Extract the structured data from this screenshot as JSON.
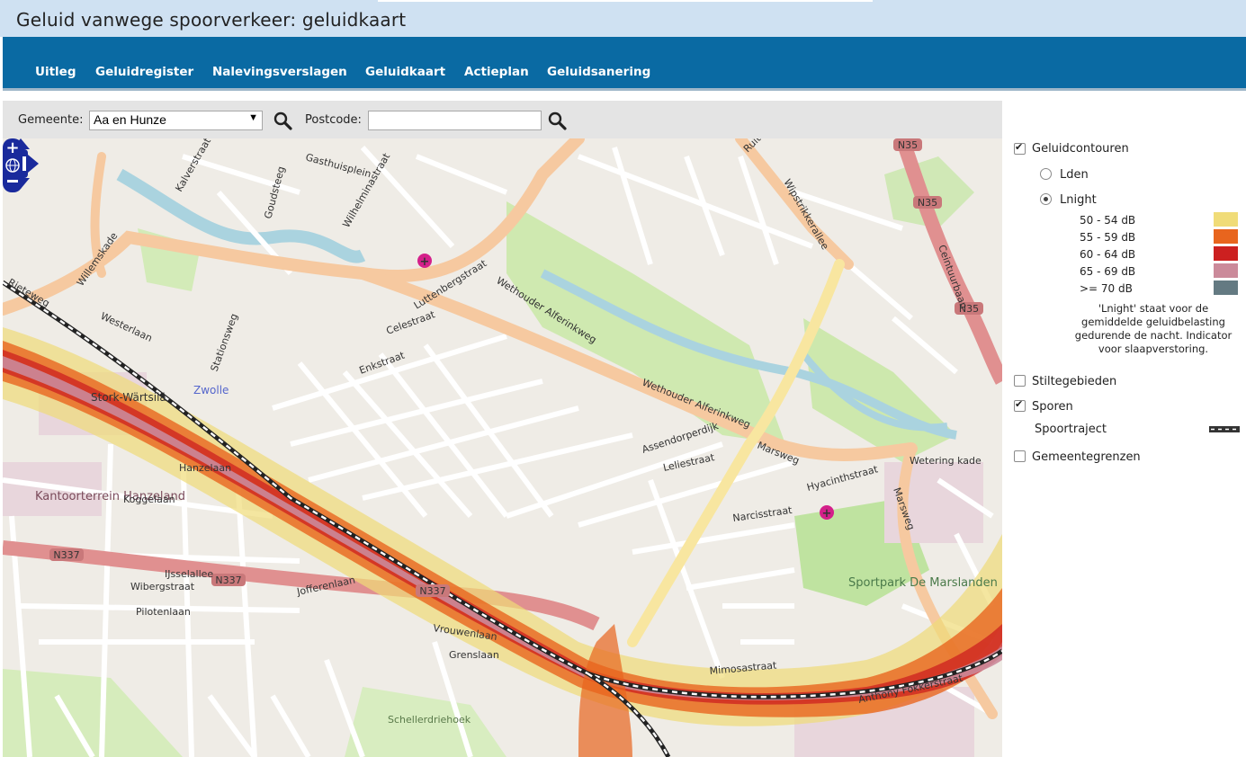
{
  "header": {
    "title": "Geluid vanwege spoorverkeer: geluidkaart"
  },
  "nav": {
    "items": [
      {
        "label": "Uitleg"
      },
      {
        "label": "Geluidregister"
      },
      {
        "label": "Nalevingsverslagen"
      },
      {
        "label": "Geluidkaart"
      },
      {
        "label": "Actieplan"
      },
      {
        "label": "Geluidsanering"
      }
    ]
  },
  "search": {
    "gemeente_label": "Gemeente:",
    "gemeente_value": "Aa en Hunze",
    "postcode_label": "Postcode:",
    "postcode_value": "",
    "search_icon": "magnifier-icon"
  },
  "panel": {
    "geluidcontouren": {
      "label": "Geluidcontouren",
      "checked": true
    },
    "lden": {
      "label": "Lden",
      "selected": false
    },
    "lnight": {
      "label": "Lnight",
      "selected": true
    },
    "legend": [
      {
        "label": "50 - 54 dB",
        "color": "#f0dc78"
      },
      {
        "label": "55 - 59 dB",
        "color": "#e8651e"
      },
      {
        "label": "60 - 64 dB",
        "color": "#cc2020"
      },
      {
        "label": "65 - 69 dB",
        "color": "#cb8a9a"
      },
      {
        "label": ">= 70 dB",
        "color": "#647a82"
      }
    ],
    "note": "'Lnight' staat voor de gemiddelde geluidbelasting gedurende de nacht. Indicator voor slaapverstoring.",
    "stiltegebieden": {
      "label": "Stiltegebieden",
      "checked": false
    },
    "sporen": {
      "label": "Sporen",
      "checked": true
    },
    "spoortraject": {
      "label": "Spoortraject"
    },
    "gemeentegrenzen": {
      "label": "Gemeentegrenzen",
      "checked": false
    }
  },
  "map": {
    "labels": [
      "Ceintuurbaan",
      "Luttenbergstraat",
      "Wethouder Alferinkweg",
      "Marsweg",
      "Willemskade",
      "Rieteweg",
      "Westerlaan",
      "Stationsweg",
      "Stork-Wärtsilä",
      "Zwolle",
      "Kantoorterrein Hanzeland",
      "Hanzelaan",
      "Koggelaan",
      "IJsselallee",
      "Schellerdriehoek",
      "Sportpark De Marslanden",
      "Assendorperdijk",
      "Celestraat",
      "Enkstraat",
      "Hyacinthstraat",
      "Leliestraat",
      "Narcisstraat",
      "Jofferenlaan",
      "Vrouwenlaan",
      "Grenslaan",
      "Pilotenlaan",
      "Wibergstraat",
      "Anthony Fokkerstraat",
      "Mimosastraat",
      "Wipstrikkerallee",
      "Wetering kade",
      "Ruiterskamp",
      "Gasthuisplein",
      "Wilhelminastraat",
      "Goudsteeg",
      "Kalverstraat"
    ],
    "shields": [
      "N35",
      "N337"
    ],
    "legend_colors": {
      "c50": "#f0dc78",
      "c55": "#e8651e",
      "c60": "#cc2020",
      "c65": "#cb8a9a",
      "c70": "#647a82"
    },
    "road_color": "#f6c9a0",
    "green_color": "#c8e6a8",
    "water_color": "#aad3df"
  }
}
